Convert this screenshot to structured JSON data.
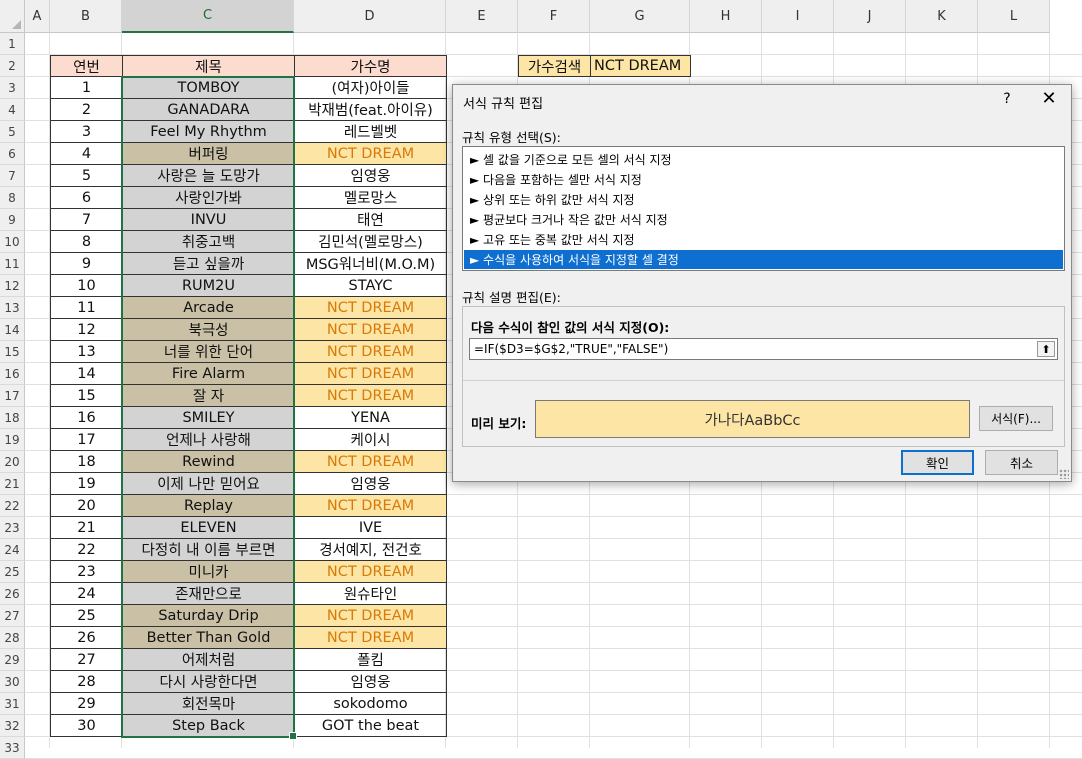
{
  "columns": [
    "A",
    "B",
    "C",
    "D",
    "E",
    "F",
    "G",
    "H",
    "I",
    "J",
    "K",
    "L"
  ],
  "rows": [
    "1",
    "2",
    "3",
    "4",
    "5",
    "6",
    "7",
    "8",
    "9",
    "10",
    "11",
    "12",
    "13",
    "14",
    "15",
    "16",
    "17",
    "18",
    "19",
    "20",
    "21",
    "22",
    "23",
    "24",
    "25",
    "26",
    "27",
    "28",
    "29",
    "30",
    "31",
    "32",
    "33"
  ],
  "table": {
    "headers": {
      "num": "연번",
      "title": "제목",
      "artist": "가수명"
    },
    "entries": [
      {
        "num": "1",
        "title": "TOMBOY",
        "artist": "(여자)아이들"
      },
      {
        "num": "2",
        "title": "GANADARA",
        "artist": "박재범(feat.아이유)"
      },
      {
        "num": "3",
        "title": "Feel My Rhythm",
        "artist": "레드벨벳"
      },
      {
        "num": "4",
        "title": "버퍼링",
        "artist": "NCT DREAM"
      },
      {
        "num": "5",
        "title": "사랑은 늘 도망가",
        "artist": "임영웅"
      },
      {
        "num": "6",
        "title": "사랑인가봐",
        "artist": "멜로망스"
      },
      {
        "num": "7",
        "title": "INVU",
        "artist": "태연"
      },
      {
        "num": "8",
        "title": "취중고백",
        "artist": "김민석(멜로망스)"
      },
      {
        "num": "9",
        "title": "듣고 싶을까",
        "artist": "MSG워너비(M.O.M)"
      },
      {
        "num": "10",
        "title": "RUM2U",
        "artist": "STAYC"
      },
      {
        "num": "11",
        "title": "Arcade",
        "artist": "NCT DREAM"
      },
      {
        "num": "12",
        "title": "북극성",
        "artist": "NCT DREAM"
      },
      {
        "num": "13",
        "title": "너를 위한 단어",
        "artist": "NCT DREAM"
      },
      {
        "num": "14",
        "title": "Fire Alarm",
        "artist": "NCT DREAM"
      },
      {
        "num": "15",
        "title": "잘 자",
        "artist": "NCT DREAM"
      },
      {
        "num": "16",
        "title": "SMILEY",
        "artist": "YENA"
      },
      {
        "num": "17",
        "title": "언제나 사랑해",
        "artist": "케이시"
      },
      {
        "num": "18",
        "title": "Rewind",
        "artist": "NCT DREAM"
      },
      {
        "num": "19",
        "title": "이제 나만 믿어요",
        "artist": "임영웅"
      },
      {
        "num": "20",
        "title": "Replay",
        "artist": "NCT DREAM"
      },
      {
        "num": "21",
        "title": "ELEVEN",
        "artist": "IVE"
      },
      {
        "num": "22",
        "title": "다정히 내 이름 부르면",
        "artist": "경서예지, 전건호"
      },
      {
        "num": "23",
        "title": "미니카",
        "artist": "NCT DREAM"
      },
      {
        "num": "24",
        "title": "존재만으로",
        "artist": "원슈타인"
      },
      {
        "num": "25",
        "title": "Saturday Drip",
        "artist": "NCT DREAM"
      },
      {
        "num": "26",
        "title": "Better Than Gold",
        "artist": "NCT DREAM"
      },
      {
        "num": "27",
        "title": "어제처럼",
        "artist": "폴킴"
      },
      {
        "num": "28",
        "title": "다시 사랑한다면",
        "artist": "임영웅"
      },
      {
        "num": "29",
        "title": "회전목마",
        "artist": "sokodomo"
      },
      {
        "num": "30",
        "title": "Step Back",
        "artist": "GOT the beat"
      }
    ]
  },
  "search": {
    "label": "가수검색",
    "value": "NCT DREAM"
  },
  "colors": {
    "highlight_fill": "#fde6a5",
    "highlight_text": "#d87a0a",
    "header_fill": "#fcdccf",
    "selection": "#217346",
    "dialog_select": "#0f6fd0"
  },
  "dialog": {
    "title": "서식 규칙 편집",
    "help": "?",
    "close": "✕",
    "rule_type_label": "규칙 유형 선택(S):",
    "rule_types": [
      "► 셀 값을 기준으로 모든 셀의 서식 지정",
      "► 다음을 포함하는 셀만 서식 지정",
      "► 상위 또는 하위 값만 서식 지정",
      "► 평균보다 크거나 작은 값만 서식 지정",
      "► 고유 또는 중복 값만 서식 지정",
      "► 수식을 사용하여 서식을 지정할 셀 결정"
    ],
    "selected_rule_index": 5,
    "edit_label": "규칙 설명 편집(E):",
    "formula_label": "다음 수식이 참인 값의 서식 지정(O):",
    "formula": "=IF($D3=$G$2,\"TRUE\",\"FALSE\")",
    "collapse_icon": "⬆",
    "preview_label": "미리 보기:",
    "preview_text": "가나다AaBbCc",
    "format_button": "서식(F)...",
    "ok": "확인",
    "cancel": "취소"
  }
}
